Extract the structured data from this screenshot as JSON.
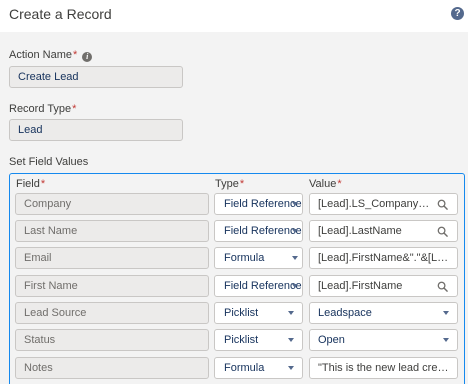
{
  "header": {
    "title": "Create a Record",
    "help_glyph": "?"
  },
  "action_name": {
    "label": "Action Name",
    "required_mark": "*",
    "info_glyph": "i",
    "value": "Create Lead"
  },
  "record_type": {
    "label": "Record Type",
    "required_mark": "*",
    "value": "Lead"
  },
  "set_field_values": {
    "label": "Set Field Values",
    "columns": {
      "field": "Field",
      "type": "Type",
      "value": "Value",
      "required_mark": "*"
    },
    "rows": [
      {
        "field": "Company",
        "type": "Field Reference",
        "value": "[Lead].LS_Company__c",
        "value_icon": "search-icon"
      },
      {
        "field": "Last Name",
        "type": "Field Reference",
        "value": "[Lead].LastName",
        "value_icon": "search-icon"
      },
      {
        "field": "Email",
        "type": "Formula",
        "value": "[Lead].FirstName&\".\"&[Lea...",
        "value_icon": ""
      },
      {
        "field": "First Name",
        "type": "Field Reference",
        "value": "[Lead].FirstName",
        "value_icon": "search-icon"
      },
      {
        "field": "Lead Source",
        "type": "Picklist",
        "value": "Leadspace",
        "value_icon": "chevron-down-icon"
      },
      {
        "field": "Status",
        "type": "Picklist",
        "value": "Open",
        "value_icon": "chevron-down-icon"
      },
      {
        "field": "Notes",
        "type": "Formula",
        "value": "\"This is the new lead create...",
        "value_icon": ""
      }
    ]
  },
  "colors": {
    "accent": "#1589ee",
    "required": "#c23934",
    "text": "#16325c",
    "panel_bg": "#f3f3f3"
  }
}
